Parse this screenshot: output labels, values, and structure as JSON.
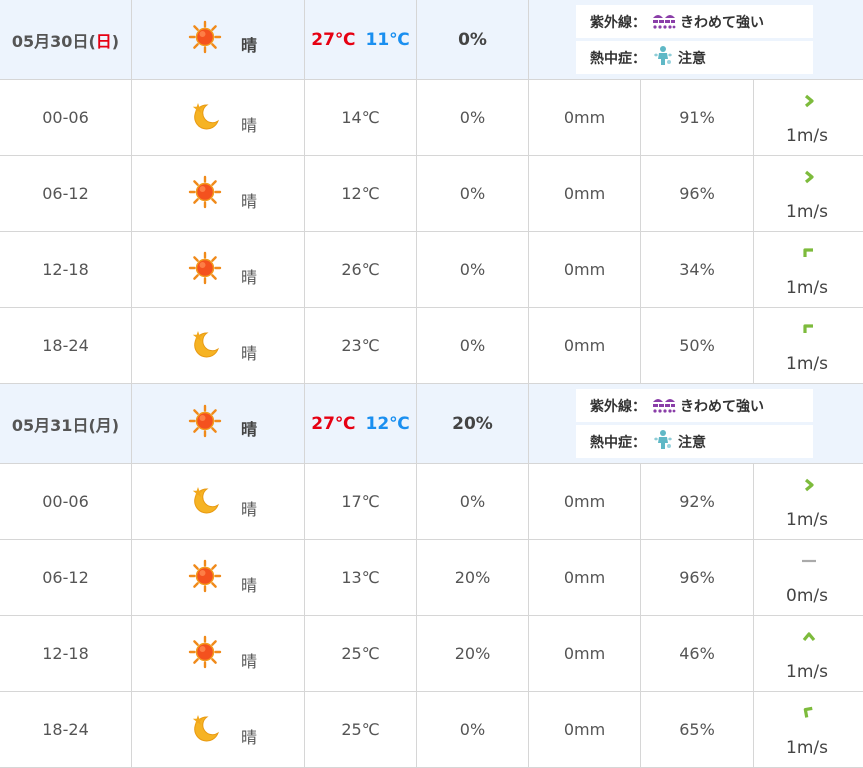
{
  "days": [
    {
      "date_main": "05月30日(",
      "weekday": "日",
      "date_close": ")",
      "weekday_holiday": true,
      "weather_icon": "sun-icon",
      "weather": "晴",
      "temp_high": "27℃",
      "temp_low": "11℃",
      "precip": "0%",
      "uv": {
        "label": "紫外線：",
        "icon": "uv-icon",
        "value": "きわめて強い"
      },
      "heat": {
        "label": "熱中症：",
        "icon": "heatstroke-icon",
        "value": "注意"
      },
      "hours": [
        {
          "range": "00-06",
          "icon": "moon-icon",
          "weather": "晴",
          "temp": "14℃",
          "pop": "0%",
          "rain": "0mm",
          "humidity": "91%",
          "wind_dir": "right",
          "wind": "1m/s"
        },
        {
          "range": "06-12",
          "icon": "sun-icon",
          "weather": "晴",
          "temp": "12℃",
          "pop": "0%",
          "rain": "0mm",
          "humidity": "96%",
          "wind_dir": "right",
          "wind": "1m/s"
        },
        {
          "range": "12-18",
          "icon": "sun-icon",
          "weather": "晴",
          "temp": "26℃",
          "pop": "0%",
          "rain": "0mm",
          "humidity": "34%",
          "wind_dir": "up-right",
          "wind": "1m/s"
        },
        {
          "range": "18-24",
          "icon": "moon-icon",
          "weather": "晴",
          "temp": "23℃",
          "pop": "0%",
          "rain": "0mm",
          "humidity": "50%",
          "wind_dir": "up-right",
          "wind": "1m/s"
        }
      ]
    },
    {
      "date_main": "05月31日(",
      "weekday": "月",
      "date_close": ")",
      "weekday_holiday": false,
      "weather_icon": "sun-icon",
      "weather": "晴",
      "temp_high": "27℃",
      "temp_low": "12℃",
      "precip": "20%",
      "uv": {
        "label": "紫外線：",
        "icon": "uv-icon",
        "value": "きわめて強い"
      },
      "heat": {
        "label": "熱中症：",
        "icon": "heatstroke-icon",
        "value": "注意"
      },
      "hours": [
        {
          "range": "00-06",
          "icon": "moon-icon",
          "weather": "晴",
          "temp": "17℃",
          "pop": "0%",
          "rain": "0mm",
          "humidity": "92%",
          "wind_dir": "right",
          "wind": "1m/s"
        },
        {
          "range": "06-12",
          "icon": "sun-icon",
          "weather": "晴",
          "temp": "13℃",
          "pop": "20%",
          "rain": "0mm",
          "humidity": "96%",
          "wind_dir": "calm",
          "wind": "0m/s"
        },
        {
          "range": "12-18",
          "icon": "sun-icon",
          "weather": "晴",
          "temp": "25℃",
          "pop": "20%",
          "rain": "0mm",
          "humidity": "46%",
          "wind_dir": "up",
          "wind": "1m/s"
        },
        {
          "range": "18-24",
          "icon": "moon-icon",
          "weather": "晴",
          "temp": "25℃",
          "pop": "0%",
          "rain": "0mm",
          "humidity": "65%",
          "wind_dir": "up-left",
          "wind": "1m/s"
        }
      ]
    }
  ],
  "colors": {
    "high_temp": "#e60012",
    "low_temp": "#1a8ff0",
    "day_row_bg": "#edf4fd",
    "wind_arrow": "#7dbb3c",
    "uv_icon": "#8a3ea8",
    "heat_icon": "#5fb8c6"
  }
}
